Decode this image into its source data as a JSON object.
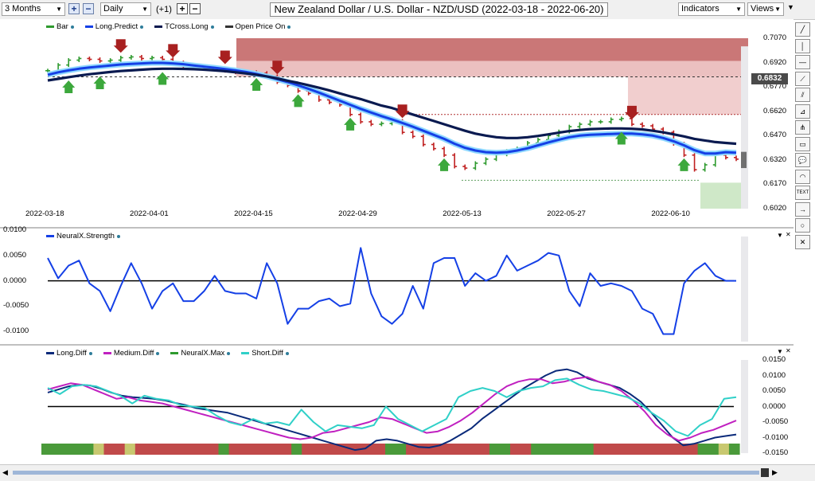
{
  "toolbar": {
    "period": "3 Months",
    "interval": "Daily",
    "offset": "(+1)",
    "title": "New Zealand Dollar / U.S. Dollar - NZD/USD (2022-03-18 - 2022-06-20)",
    "indicators_label": "Indicators",
    "views_label": "Views",
    "plus_glyph": "+",
    "minus_glyph": "−"
  },
  "right_tools": [
    {
      "name": "trend-line-tool-icon",
      "glyph": "╱"
    },
    {
      "name": "vertical-line-tool-icon",
      "glyph": "│"
    },
    {
      "name": "horizontal-line-tool-icon",
      "glyph": "—"
    },
    {
      "name": "fibonacci-tool-icon",
      "glyph": "⟋"
    },
    {
      "name": "channel-tool-icon",
      "glyph": "⫽"
    },
    {
      "name": "gann-tool-icon",
      "glyph": "⊿"
    },
    {
      "name": "pitchfork-tool-icon",
      "glyph": "⋔"
    },
    {
      "name": "rectangle-tool-icon",
      "glyph": "▭"
    },
    {
      "name": "callout-tool-icon",
      "glyph": "💬"
    },
    {
      "name": "arc-tool-icon",
      "glyph": "◠"
    },
    {
      "name": "text-tool-icon",
      "glyph": "TEXT"
    },
    {
      "name": "arrow-tool-icon",
      "glyph": "→"
    },
    {
      "name": "ellipse-tool-icon",
      "glyph": "○"
    },
    {
      "name": "delete-tool-icon",
      "glyph": "✕"
    }
  ],
  "price_panel": {
    "legend": [
      {
        "label": "Bar",
        "color": "#2e9a2e"
      },
      {
        "label": "Long.Predict",
        "color": "#1540e6"
      },
      {
        "label": "TCross.Long",
        "color": "#0a1a50"
      },
      {
        "label": "Open Price On",
        "color": "#333333"
      }
    ],
    "y_ticks": [
      "0.7070",
      "0.6920",
      "0.6770",
      "0.6620",
      "0.6470",
      "0.6320",
      "0.6170",
      "0.6020"
    ],
    "current_price": "0.6832",
    "x_ticks": [
      "2022-03-18",
      "2022-04-01",
      "2022-04-15",
      "2022-04-29",
      "2022-05-13",
      "2022-05-27",
      "2022-06-10"
    ]
  },
  "strength_panel": {
    "legend": [
      {
        "label": "NeuralX.Strength",
        "color": "#1540e6"
      }
    ],
    "y_ticks": [
      "0.0100",
      "0.0050",
      "0.0000",
      "-0.0050",
      "-0.0100"
    ]
  },
  "diff_panel": {
    "legend": [
      {
        "label": "Long.Diff",
        "color": "#0a2a7a"
      },
      {
        "label": "Medium.Diff",
        "color": "#c020c0"
      },
      {
        "label": "NeuralX.Max",
        "color": "#2e9a2e"
      },
      {
        "label": "Short.Diff",
        "color": "#30d0c8"
      }
    ],
    "y_ticks": [
      "0.0150",
      "0.0100",
      "0.0050",
      "0.0000",
      "-0.0050",
      "-0.0100",
      "-0.0150"
    ]
  },
  "chart_data": [
    {
      "type": "line",
      "x": [
        "2022-03-18",
        "2022-03-21",
        "2022-03-22",
        "2022-03-23",
        "2022-03-24",
        "2022-03-25",
        "2022-03-28",
        "2022-03-29",
        "2022-03-30",
        "2022-03-31",
        "2022-04-01",
        "2022-04-04",
        "2022-04-05",
        "2022-04-06",
        "2022-04-07",
        "2022-04-08",
        "2022-04-11",
        "2022-04-12",
        "2022-04-13",
        "2022-04-14",
        "2022-04-15",
        "2022-04-18",
        "2022-04-19",
        "2022-04-20",
        "2022-04-21",
        "2022-04-22",
        "2022-04-25",
        "2022-04-26",
        "2022-04-27",
        "2022-04-28",
        "2022-04-29",
        "2022-05-02",
        "2022-05-03",
        "2022-05-04",
        "2022-05-05",
        "2022-05-06",
        "2022-05-09",
        "2022-05-10",
        "2022-05-11",
        "2022-05-12",
        "2022-05-13",
        "2022-05-16",
        "2022-05-17",
        "2022-05-18",
        "2022-05-19",
        "2022-05-20",
        "2022-05-23",
        "2022-05-24",
        "2022-05-25",
        "2022-05-26",
        "2022-05-27",
        "2022-05-30",
        "2022-05-31",
        "2022-06-01",
        "2022-06-02",
        "2022-06-03",
        "2022-06-06",
        "2022-06-07",
        "2022-06-08",
        "2022-06-09",
        "2022-06-10",
        "2022-06-13",
        "2022-06-14",
        "2022-06-15",
        "2022-06-16",
        "2022-06-17",
        "2022-06-20"
      ],
      "series": [
        {
          "name": "Bar",
          "values": [
            0.687,
            0.6905,
            0.6935,
            0.6945,
            0.694,
            0.693,
            0.6935,
            0.695,
            0.6955,
            0.6945,
            0.695,
            0.694,
            0.692,
            0.69,
            0.6885,
            0.6885,
            0.688,
            0.687,
            0.686,
            0.686,
            0.6855,
            0.6835,
            0.68,
            0.678,
            0.6745,
            0.673,
            0.669,
            0.6675,
            0.666,
            0.66,
            0.6555,
            0.654,
            0.6545,
            0.656,
            0.649,
            0.6465,
            0.6415,
            0.639,
            0.635,
            0.628,
            0.627,
            0.63,
            0.6325,
            0.6355,
            0.6375,
            0.639,
            0.6425,
            0.6445,
            0.647,
            0.6495,
            0.6525,
            0.654,
            0.6555,
            0.6555,
            0.657,
            0.6575,
            0.654,
            0.653,
            0.651,
            0.649,
            0.642,
            0.635,
            0.626,
            0.629,
            0.635,
            0.6335,
            0.6325
          ]
        },
        {
          "name": "Long.Predict",
          "values": [
            0.6845,
            0.686,
            0.6872,
            0.6882,
            0.689,
            0.6896,
            0.6902,
            0.6908,
            0.6912,
            0.6915,
            0.6918,
            0.6918,
            0.6915,
            0.691,
            0.6902,
            0.6895,
            0.6888,
            0.688,
            0.6872,
            0.6862,
            0.685,
            0.6835,
            0.6818,
            0.68,
            0.678,
            0.6758,
            0.6735,
            0.671,
            0.6685,
            0.666,
            0.6635,
            0.6612,
            0.659,
            0.657,
            0.6548,
            0.6525,
            0.65,
            0.6475,
            0.645,
            0.642,
            0.6395,
            0.6378,
            0.6368,
            0.6365,
            0.6368,
            0.6378,
            0.6392,
            0.641,
            0.6428,
            0.6445,
            0.646,
            0.647,
            0.6475,
            0.6478,
            0.648,
            0.6482,
            0.6482,
            0.6478,
            0.647,
            0.6455,
            0.6435,
            0.641,
            0.638,
            0.636,
            0.636,
            0.6368,
            0.6365
          ]
        },
        {
          "name": "TCross.Long",
          "values": [
            0.681,
            0.682,
            0.683,
            0.684,
            0.6848,
            0.6855,
            0.6862,
            0.6868,
            0.6872,
            0.6876,
            0.688,
            0.6882,
            0.6882,
            0.6881,
            0.6879,
            0.6876,
            0.6872,
            0.6867,
            0.686,
            0.6853,
            0.6845,
            0.6835,
            0.6822,
            0.6808,
            0.6795,
            0.678,
            0.6765,
            0.6748,
            0.673,
            0.6712,
            0.6695,
            0.6675,
            0.6655,
            0.664,
            0.662,
            0.66,
            0.658,
            0.656,
            0.654,
            0.652,
            0.65,
            0.6482,
            0.647,
            0.646,
            0.6455,
            0.6455,
            0.646,
            0.6468,
            0.6478,
            0.6488,
            0.6498,
            0.6505,
            0.651,
            0.6512,
            0.6514,
            0.6514,
            0.6512,
            0.6508,
            0.65,
            0.649,
            0.6478,
            0.6465,
            0.645,
            0.644,
            0.643,
            0.6425,
            0.642
          ]
        }
      ],
      "ylim": [
        0.602,
        0.707
      ],
      "reference_lines": [
        {
          "label": "Open Price On",
          "value": 0.6832
        }
      ]
    },
    {
      "type": "line",
      "series": [
        {
          "name": "NeuralX.Strength",
          "values": [
            0.0045,
            0.0005,
            0.003,
            0.004,
            -0.0005,
            -0.002,
            -0.006,
            -0.001,
            0.0035,
            -0.0005,
            -0.0055,
            -0.002,
            -0.0005,
            -0.004,
            -0.004,
            -0.002,
            0.001,
            -0.002,
            -0.0025,
            -0.0025,
            -0.0035,
            0.0035,
            -0.0005,
            -0.0085,
            -0.0055,
            -0.0055,
            -0.004,
            -0.0035,
            -0.005,
            -0.0045,
            0.0065,
            -0.0025,
            -0.007,
            -0.0085,
            -0.0065,
            -0.001,
            -0.0055,
            0.0035,
            0.0045,
            0.0045,
            -0.001,
            0.0015,
            0.0,
            0.001,
            0.005,
            0.002,
            0.003,
            0.004,
            0.0055,
            0.005,
            -0.002,
            -0.005,
            0.0015,
            -0.001,
            -0.0005,
            -0.001,
            -0.002,
            -0.0055,
            -0.0065,
            -0.0105,
            -0.0105,
            -0.0005,
            0.002,
            0.0035,
            0.001,
            0.0,
            0.0
          ]
        }
      ],
      "ylim": [
        -0.012,
        0.01
      ]
    },
    {
      "type": "line",
      "series": [
        {
          "name": "Long.Diff",
          "values": [
            0.0045,
            0.0055,
            0.0065,
            0.007,
            0.0068,
            0.0058,
            0.0045,
            0.0035,
            0.003,
            0.0028,
            0.0025,
            0.002,
            0.0012,
            0.0005,
            -0.0005,
            -0.001,
            -0.0015,
            -0.002,
            -0.003,
            -0.004,
            -0.005,
            -0.006,
            -0.007,
            -0.008,
            -0.009,
            -0.01,
            -0.011,
            -0.012,
            -0.013,
            -0.014,
            -0.0135,
            -0.011,
            -0.0105,
            -0.011,
            -0.012,
            -0.013,
            -0.0132,
            -0.0125,
            -0.011,
            -0.009,
            -0.007,
            -0.004,
            -0.0015,
            0.001,
            0.0035,
            0.006,
            0.008,
            0.01,
            0.0115,
            0.012,
            0.011,
            0.009,
            0.008,
            0.007,
            0.006,
            0.004,
            0.0015,
            -0.002,
            -0.006,
            -0.01,
            -0.0125,
            -0.012,
            -0.011,
            -0.01,
            -0.0095,
            -0.009
          ]
        },
        {
          "name": "Medium.Diff",
          "values": [
            0.0055,
            0.0065,
            0.0075,
            0.007,
            0.0055,
            0.004,
            0.0025,
            0.003,
            0.002,
            0.0015,
            0.001,
            0.0,
            -0.001,
            -0.002,
            -0.003,
            -0.004,
            -0.005,
            -0.006,
            -0.007,
            -0.008,
            -0.009,
            -0.01,
            -0.0105,
            -0.01,
            -0.0085,
            -0.008,
            -0.007,
            -0.006,
            -0.005,
            -0.0035,
            -0.004,
            -0.0055,
            -0.007,
            -0.0085,
            -0.008,
            -0.0065,
            -0.0045,
            -0.002,
            0.001,
            0.004,
            0.0065,
            0.008,
            0.0088,
            0.0088,
            0.0075,
            0.008,
            0.009,
            0.0095,
            0.008,
            0.007,
            0.005,
            0.002,
            -0.0015,
            -0.006,
            -0.009,
            -0.011,
            -0.01,
            -0.0085,
            -0.0075,
            -0.006,
            -0.0045
          ]
        },
        {
          "name": "Short.Diff",
          "values": [
            0.006,
            0.004,
            0.0065,
            0.007,
            0.0065,
            0.005,
            0.0035,
            0.001,
            0.0035,
            0.0025,
            0.002,
            0.0005,
            0.0,
            -0.0005,
            -0.003,
            -0.005,
            -0.006,
            -0.004,
            -0.0055,
            -0.005,
            -0.006,
            -0.001,
            -0.005,
            -0.008,
            -0.006,
            -0.0065,
            -0.007,
            -0.006,
            0.0,
            -0.004,
            -0.006,
            -0.008,
            -0.006,
            -0.004,
            0.003,
            0.005,
            0.006,
            0.005,
            0.003,
            0.005,
            0.006,
            0.0065,
            0.0085,
            0.009,
            0.007,
            0.0055,
            0.005,
            0.004,
            0.003,
            0.001,
            -0.002,
            -0.0045,
            -0.008,
            -0.0095,
            -0.006,
            -0.004,
            0.0025,
            0.003
          ]
        }
      ],
      "ylim": [
        -0.015,
        0.015
      ]
    }
  ]
}
